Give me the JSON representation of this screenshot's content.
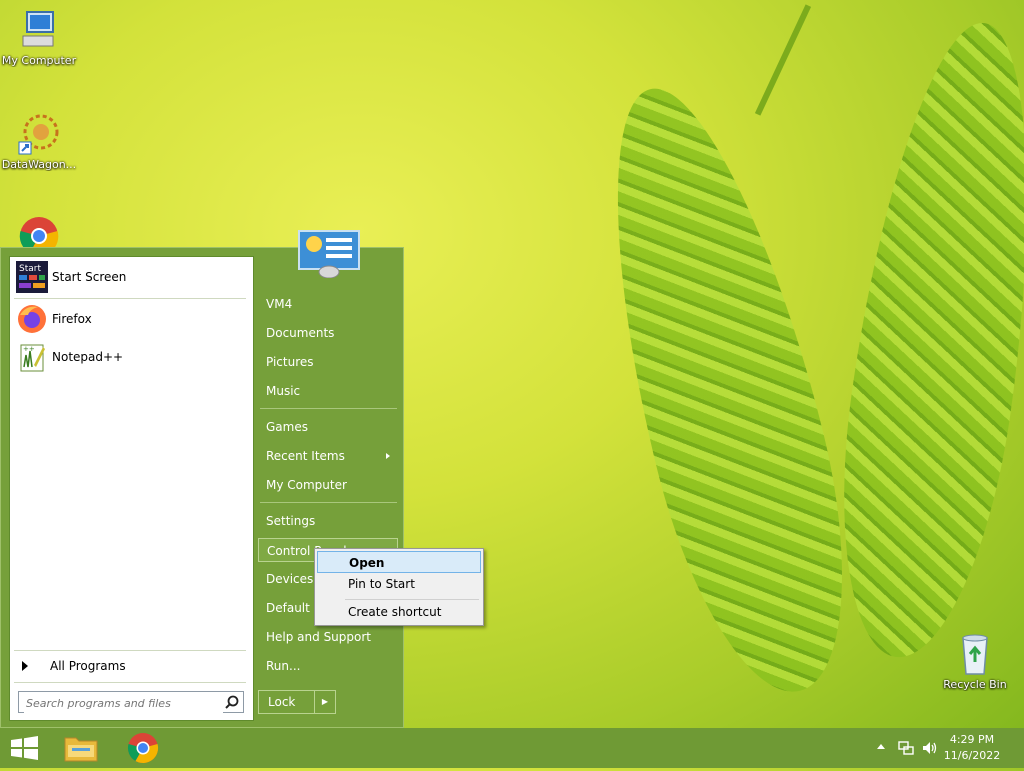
{
  "desktop": {
    "icons": [
      {
        "label": "My Computer"
      },
      {
        "label": "DataWagon..."
      },
      {
        "label": "Recycle Bin"
      }
    ]
  },
  "start_menu": {
    "programs": [
      {
        "label": "Start Screen",
        "icon": "start-screen-icon"
      },
      {
        "label": "Firefox",
        "icon": "firefox-icon"
      },
      {
        "label": "Notepad++",
        "icon": "notepadpp-icon"
      }
    ],
    "all_programs": "All Programs",
    "search_placeholder": "Search programs and files",
    "right": [
      {
        "label": "VM4"
      },
      {
        "label": "Documents"
      },
      {
        "label": "Pictures"
      },
      {
        "label": "Music"
      },
      {
        "label": "Games"
      },
      {
        "label": "Recent Items"
      },
      {
        "label": "My Computer"
      },
      {
        "label": "Settings"
      },
      {
        "label": "Control Panel"
      },
      {
        "label": "Devices and Printers"
      },
      {
        "label": "Default Programs"
      },
      {
        "label": "Help and Support"
      },
      {
        "label": "Run..."
      }
    ],
    "lock": "Lock"
  },
  "context_menu": {
    "items": [
      {
        "label": "Open"
      },
      {
        "label": "Pin to Start"
      },
      {
        "label": "Create shortcut"
      }
    ]
  },
  "taskbar": {
    "time": "4:29 PM",
    "date": "11/6/2022"
  },
  "colors": {
    "start_menu_bg": "#76a03a",
    "taskbar_bg": "#6f9a35",
    "ctx_highlight": "#d9ebf9"
  }
}
